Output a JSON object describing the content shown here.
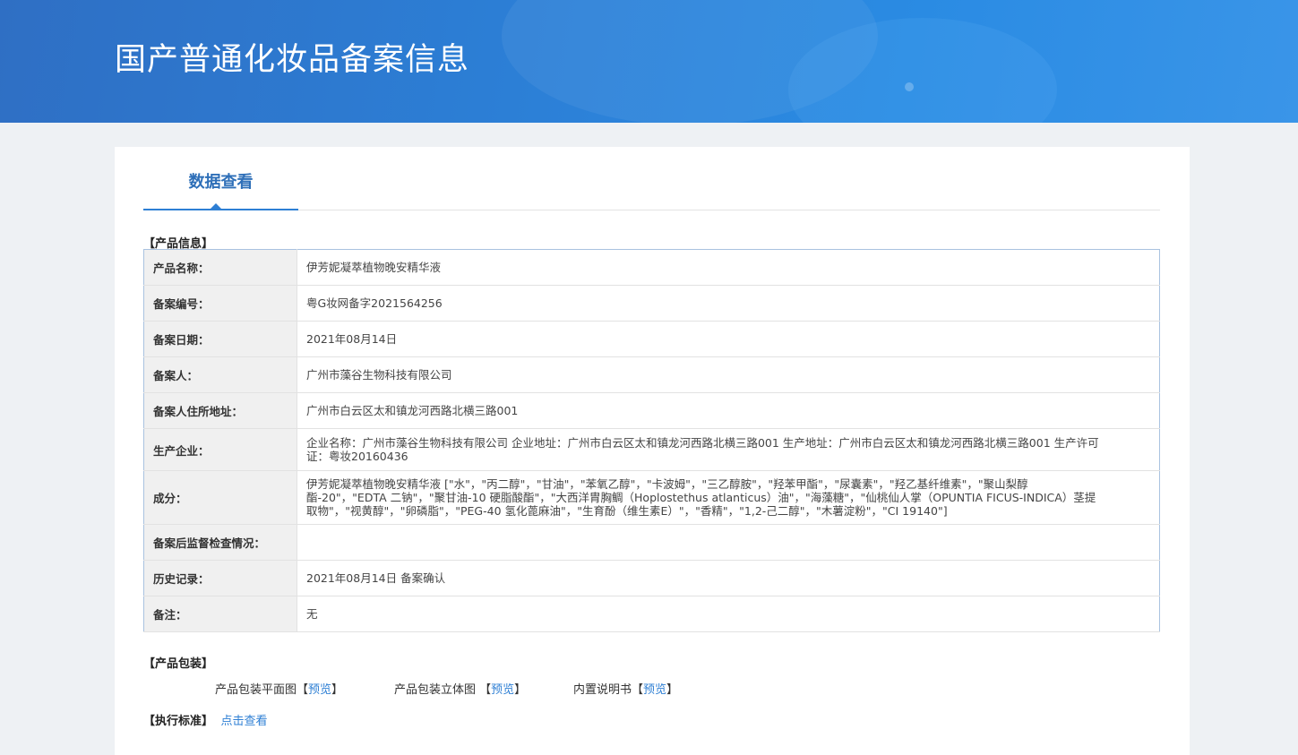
{
  "header": {
    "title": "国产普通化妆品备案信息"
  },
  "tabs": [
    {
      "label": "数据查看"
    }
  ],
  "product_section": {
    "label": "【产品信息】"
  },
  "rows": [
    {
      "key": "产品名称：",
      "value": "伊芳妮凝萃植物晚安精华液"
    },
    {
      "key": "备案编号：",
      "value": "粤G妆网备字2021564256"
    },
    {
      "key": "备案日期：",
      "value": "2021年08月14日"
    },
    {
      "key": "备案人：",
      "value": "广州市藻谷生物科技有限公司"
    },
    {
      "key": "备案人住所地址：",
      "value": "广州市白云区太和镇龙河西路北横三路001"
    },
    {
      "key": "生产企业：",
      "value": "企业名称：广州市藻谷生物科技有限公司 企业地址：广州市白云区太和镇龙河西路北横三路001 生产地址：广州市白云区太和镇龙河西路北横三路001 生产许可证：粤妆20160436"
    },
    {
      "key": "成分：",
      "value": "伊芳妮凝萃植物晚安精华液 [\"水\"，\"丙二醇\"，\"甘油\"，\"苯氧乙醇\"，\"卡波姆\"，\"三乙醇胺\"，\"羟苯甲酯\"，\"尿囊素\"，\"羟乙基纤维素\"，\"聚山梨醇酯-20\"，\"EDTA 二钠\"，\"聚甘油-10 硬脂酸酯\"，\"大西洋胄胸鲷（Hoplostethus atlanticus）油\"，\"海藻糖\"，\"仙桃仙人掌（OPUNTIA FICUS-INDICA）茎提取物\"，\"视黄醇\"，\"卵磷脂\"，\"PEG-40 氢化蓖麻油\"，\"生育酚（维生素E）\"，\"香精\"，\"1,2-己二醇\"，\"木薯淀粉\"，\"CI 19140\"]"
    },
    {
      "key": "备案后监督检查情况：",
      "value": ""
    },
    {
      "key": "历史记录：",
      "value": "2021年08月14日 备案确认"
    },
    {
      "key": "备注：",
      "value": "无"
    }
  ],
  "packaging": {
    "label": "【产品包装】",
    "items": [
      {
        "name": "产品包装平面图",
        "open": "【",
        "link": "预览",
        "close": "】"
      },
      {
        "name": "产品包装立体图",
        "open": " 【",
        "link": "预览",
        "close": "】"
      },
      {
        "name": "内置说明书",
        "open": "【",
        "link": "预览",
        "close": "】"
      }
    ]
  },
  "standard": {
    "label": "【执行标准】",
    "link": "点击查看"
  },
  "colors": {
    "banner": "#2c7fd6",
    "accent": "#2e7fd4",
    "tab_text": "#2e6fb8",
    "table_border": "#a9c2e0"
  }
}
